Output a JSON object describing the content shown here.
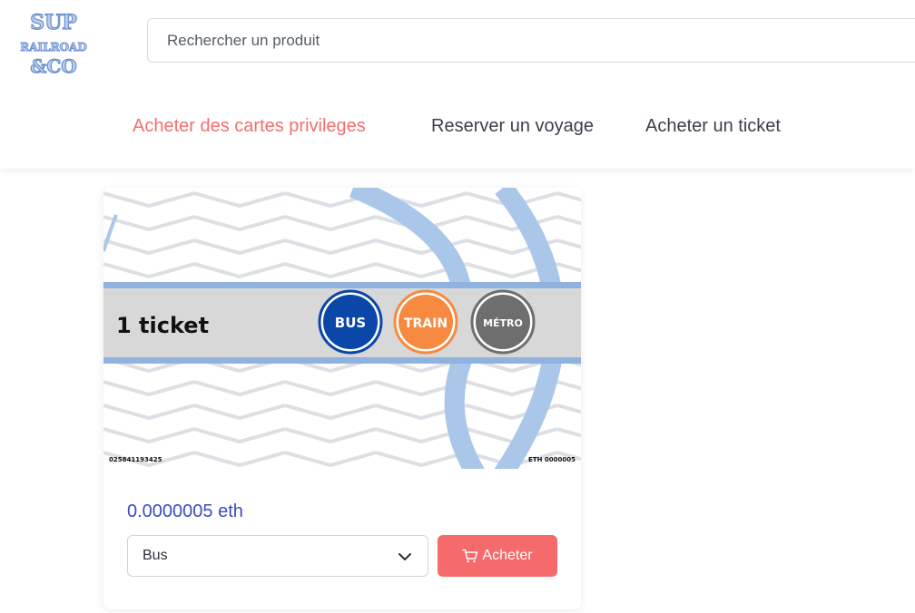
{
  "logo": {
    "lines": [
      "SUP",
      "RAILROAD",
      "&CO"
    ]
  },
  "search": {
    "placeholder": "Rechercher un produit"
  },
  "nav": {
    "items": [
      {
        "label": "Acheter des cartes privileges",
        "active": true
      },
      {
        "label": "Reserver un voyage",
        "active": false
      },
      {
        "label": "Acheter un ticket",
        "active": false
      }
    ]
  },
  "product": {
    "ticket_title": "1 ticket",
    "badges": [
      {
        "label": "BUS",
        "color": "#0a47a8"
      },
      {
        "label": "TRAIN",
        "color": "#f58a40"
      },
      {
        "label": "MÉTRO",
        "color": "#6e6e6e"
      }
    ],
    "serial_left": "025841193425",
    "serial_right": "ETH  0000005",
    "price": "0.0000005 eth",
    "select_value": "Bus",
    "buy_label": "Acheter"
  },
  "colors": {
    "accent": "#f26f6f",
    "price": "#3b4bc0",
    "button": "#f56a6a",
    "stripe": "#8fb2df"
  }
}
